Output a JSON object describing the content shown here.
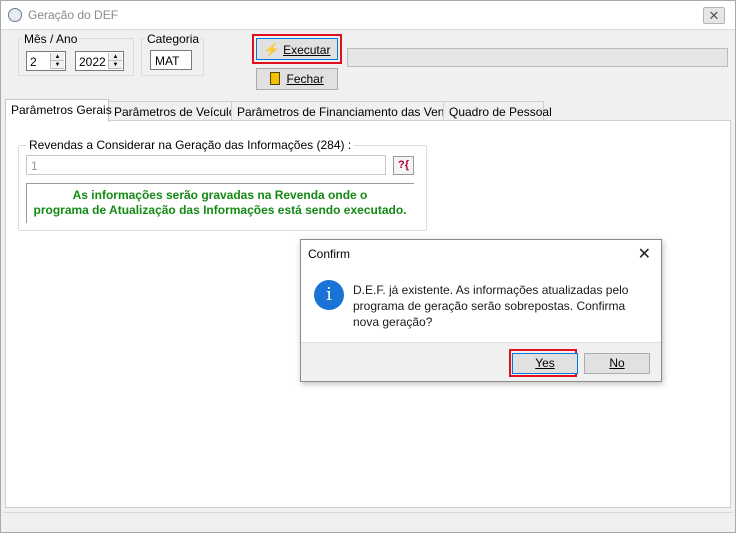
{
  "window": {
    "title": "Geração do DEF",
    "close_glyph": "✕"
  },
  "period": {
    "label": "Mês / Ano",
    "month": "2",
    "year": "2022"
  },
  "category": {
    "label": "Categoria",
    "value": "MAT"
  },
  "toolbar": {
    "run_label": "Executar",
    "close_label": "Fechar"
  },
  "tabs": [
    {
      "label": "Parâmetros Gerais"
    },
    {
      "label": "Parâmetros de Veículos"
    },
    {
      "label": "Parâmetros de Financiamento das Vendas"
    },
    {
      "label": "Quadro de Pessoal"
    }
  ],
  "general": {
    "dealers_label": "Revendas a Considerar na Geração das Informações (284) :",
    "dealers_value": "1",
    "lookup_glyph": "?{",
    "info_line1": "As informações serão gravadas na Revenda onde o",
    "info_line2": "programa de Atualização das Informações está sendo executado.",
    "info_color": "#138a13"
  },
  "dialog": {
    "title": "Confirm",
    "close_glyph": "✕",
    "icon": "information-icon",
    "message": "D.E.F. já existente. As informações atualizadas pelo programa de geração serão sobrepostas. Confirma nova geração?",
    "yes_label": "Yes",
    "no_label": "No"
  },
  "colors": {
    "highlight": "#e0101f",
    "accent": "#1a73d6"
  }
}
